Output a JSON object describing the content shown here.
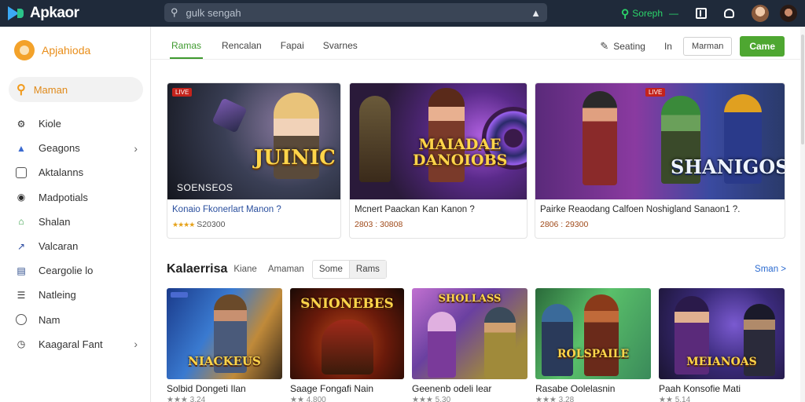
{
  "app": {
    "name": "Apkaor"
  },
  "search": {
    "placeholder": "gulk sengah"
  },
  "topbar": {
    "selector_label": "Soreph"
  },
  "sidebar": {
    "brand": "Apjahioda",
    "active": {
      "label": "Maman",
      "icon": "search-icon"
    },
    "items": [
      {
        "label": "Kiole",
        "icon": "gear-icon",
        "chevron": false
      },
      {
        "label": "Geagons",
        "icon": "shield-icon",
        "chevron": true
      },
      {
        "label": "Aktalanns",
        "icon": "box-icon",
        "chevron": false
      },
      {
        "label": "Madpotials",
        "icon": "controller-icon",
        "chevron": false
      },
      {
        "label": "Shalan",
        "icon": "house-icon",
        "chevron": false
      },
      {
        "label": "Valcaran",
        "icon": "bolt-icon",
        "chevron": false
      },
      {
        "label": "Ceargolie lo",
        "icon": "chart-icon",
        "chevron": false
      },
      {
        "label": "Natleing",
        "icon": "list-icon",
        "chevron": false
      },
      {
        "label": "Nam",
        "icon": "circle-icon",
        "chevron": false
      },
      {
        "label": "Kaagaral Fant",
        "icon": "clock-icon",
        "chevron": true
      }
    ]
  },
  "tabs": [
    "Ramas",
    "Rencalan",
    "Fapai",
    "Svarnes"
  ],
  "header_actions": {
    "edit_label": "Seating",
    "in_label": "In",
    "outline_button": "Marman",
    "primary_button": "Came"
  },
  "featured": [
    {
      "badge": "LIVE",
      "art_title": "JUINIC",
      "art_caption": "SOENSEOS",
      "title": "Konaio Fkonerlart Manon ?",
      "rating": "★★★★",
      "meta": "S20300"
    },
    {
      "badge": "",
      "art_title": "MAIADAE DANOIOBS",
      "art_caption": "",
      "title": "Mcnert Paackan Kan Kanon ?",
      "rating": "",
      "meta": "2803 : 30808"
    },
    {
      "badge": "LIVE",
      "art_title": "SHANIGOS",
      "art_caption": "",
      "title": "Pairke Reaodang Calfoen Noshigland Sanaon1 ?.",
      "rating": "",
      "meta": "2806 : 29300"
    }
  ],
  "category": {
    "title": "Kalaerrisa",
    "chips": [
      "Kiane",
      "Amaman"
    ],
    "toggle": [
      "Some",
      "Rams"
    ],
    "selected_toggle": "Rams",
    "see_more": "Sman >"
  },
  "cards": [
    {
      "art_title": "NIACKEUS",
      "title": "Solbid Dongeti Ilan",
      "meta": "★★★ 3.24"
    },
    {
      "art_title": "SNIONEBES",
      "title": "Saage Fongafi Nain",
      "meta": "★★ 4.800"
    },
    {
      "art_title": "SHOLLASS",
      "title": "Geenenb odeli lear",
      "meta": "★★★ 5.30"
    },
    {
      "art_title": "ROLSPAILE",
      "title": "Rasabe Oolelasnin",
      "meta": "★★★ 3.28"
    },
    {
      "art_title": "MEIANOAS",
      "title": "Paah Konsofie Mati",
      "meta": "★★ 5.14"
    }
  ],
  "colors": {
    "topbar": "#1f2a3a",
    "accent_green": "#4ea731",
    "accent_orange": "#e98e1a",
    "link_blue": "#2a4f9e"
  }
}
